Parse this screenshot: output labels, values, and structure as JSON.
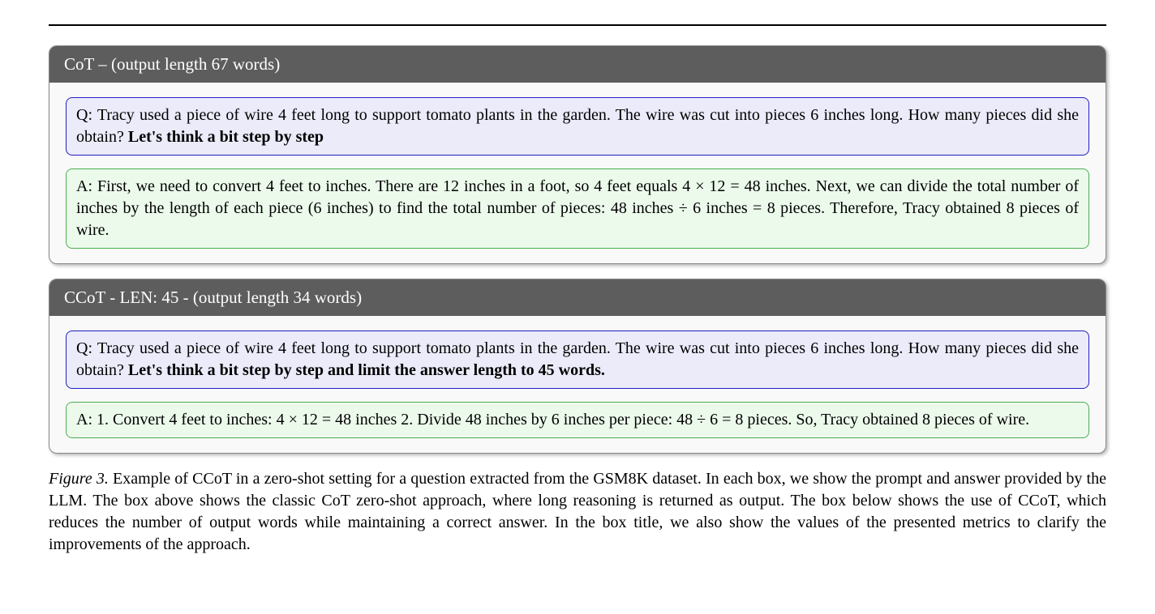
{
  "box1": {
    "header": "CoT – (output length 67 words)",
    "q_main": "Q: Tracy used a piece of wire 4 feet long to support tomato plants in the garden. The wire was cut into pieces 6 inches long. How many pieces did she obtain? ",
    "q_bold": "Let's think a bit step by step",
    "a": "A: First, we need to convert 4 feet to inches. There are 12 inches in a foot, so 4 feet equals 4 × 12 = 48 inches. Next, we can divide the total number of inches by the length of each piece (6 inches) to find the total number of pieces: 48 inches ÷ 6 inches = 8 pieces. Therefore, Tracy obtained 8 pieces of wire."
  },
  "box2": {
    "header": "CCoT - LEN: 45 - (output length 34 words)",
    "q_main": "Q: Tracy used a piece of wire 4 feet long to support tomato plants in the garden. The wire was cut into pieces 6 inches long. How many pieces did she obtain? ",
    "q_bold": "Let's think a bit step by step and limit the answer length to 45 words.",
    "a": "A: 1. Convert 4 feet to inches: 4 × 12 = 48 inches 2. Divide 48 inches by 6 inches per piece: 48 ÷ 6 = 8 pieces. So, Tracy obtained 8 pieces of wire."
  },
  "caption": {
    "label": "Figure 3.",
    "text": " Example of CCoT in a zero-shot setting for a question extracted from the GSM8K dataset. In each box, we show the prompt and answer provided by the LLM. The box above shows the classic CoT zero-shot approach, where long reasoning is returned as output. The box below shows the use of CCoT, which reduces the number of output words while maintaining a correct answer. In the box title, we also show the values of the presented metrics to clarify the improvements of the approach."
  }
}
